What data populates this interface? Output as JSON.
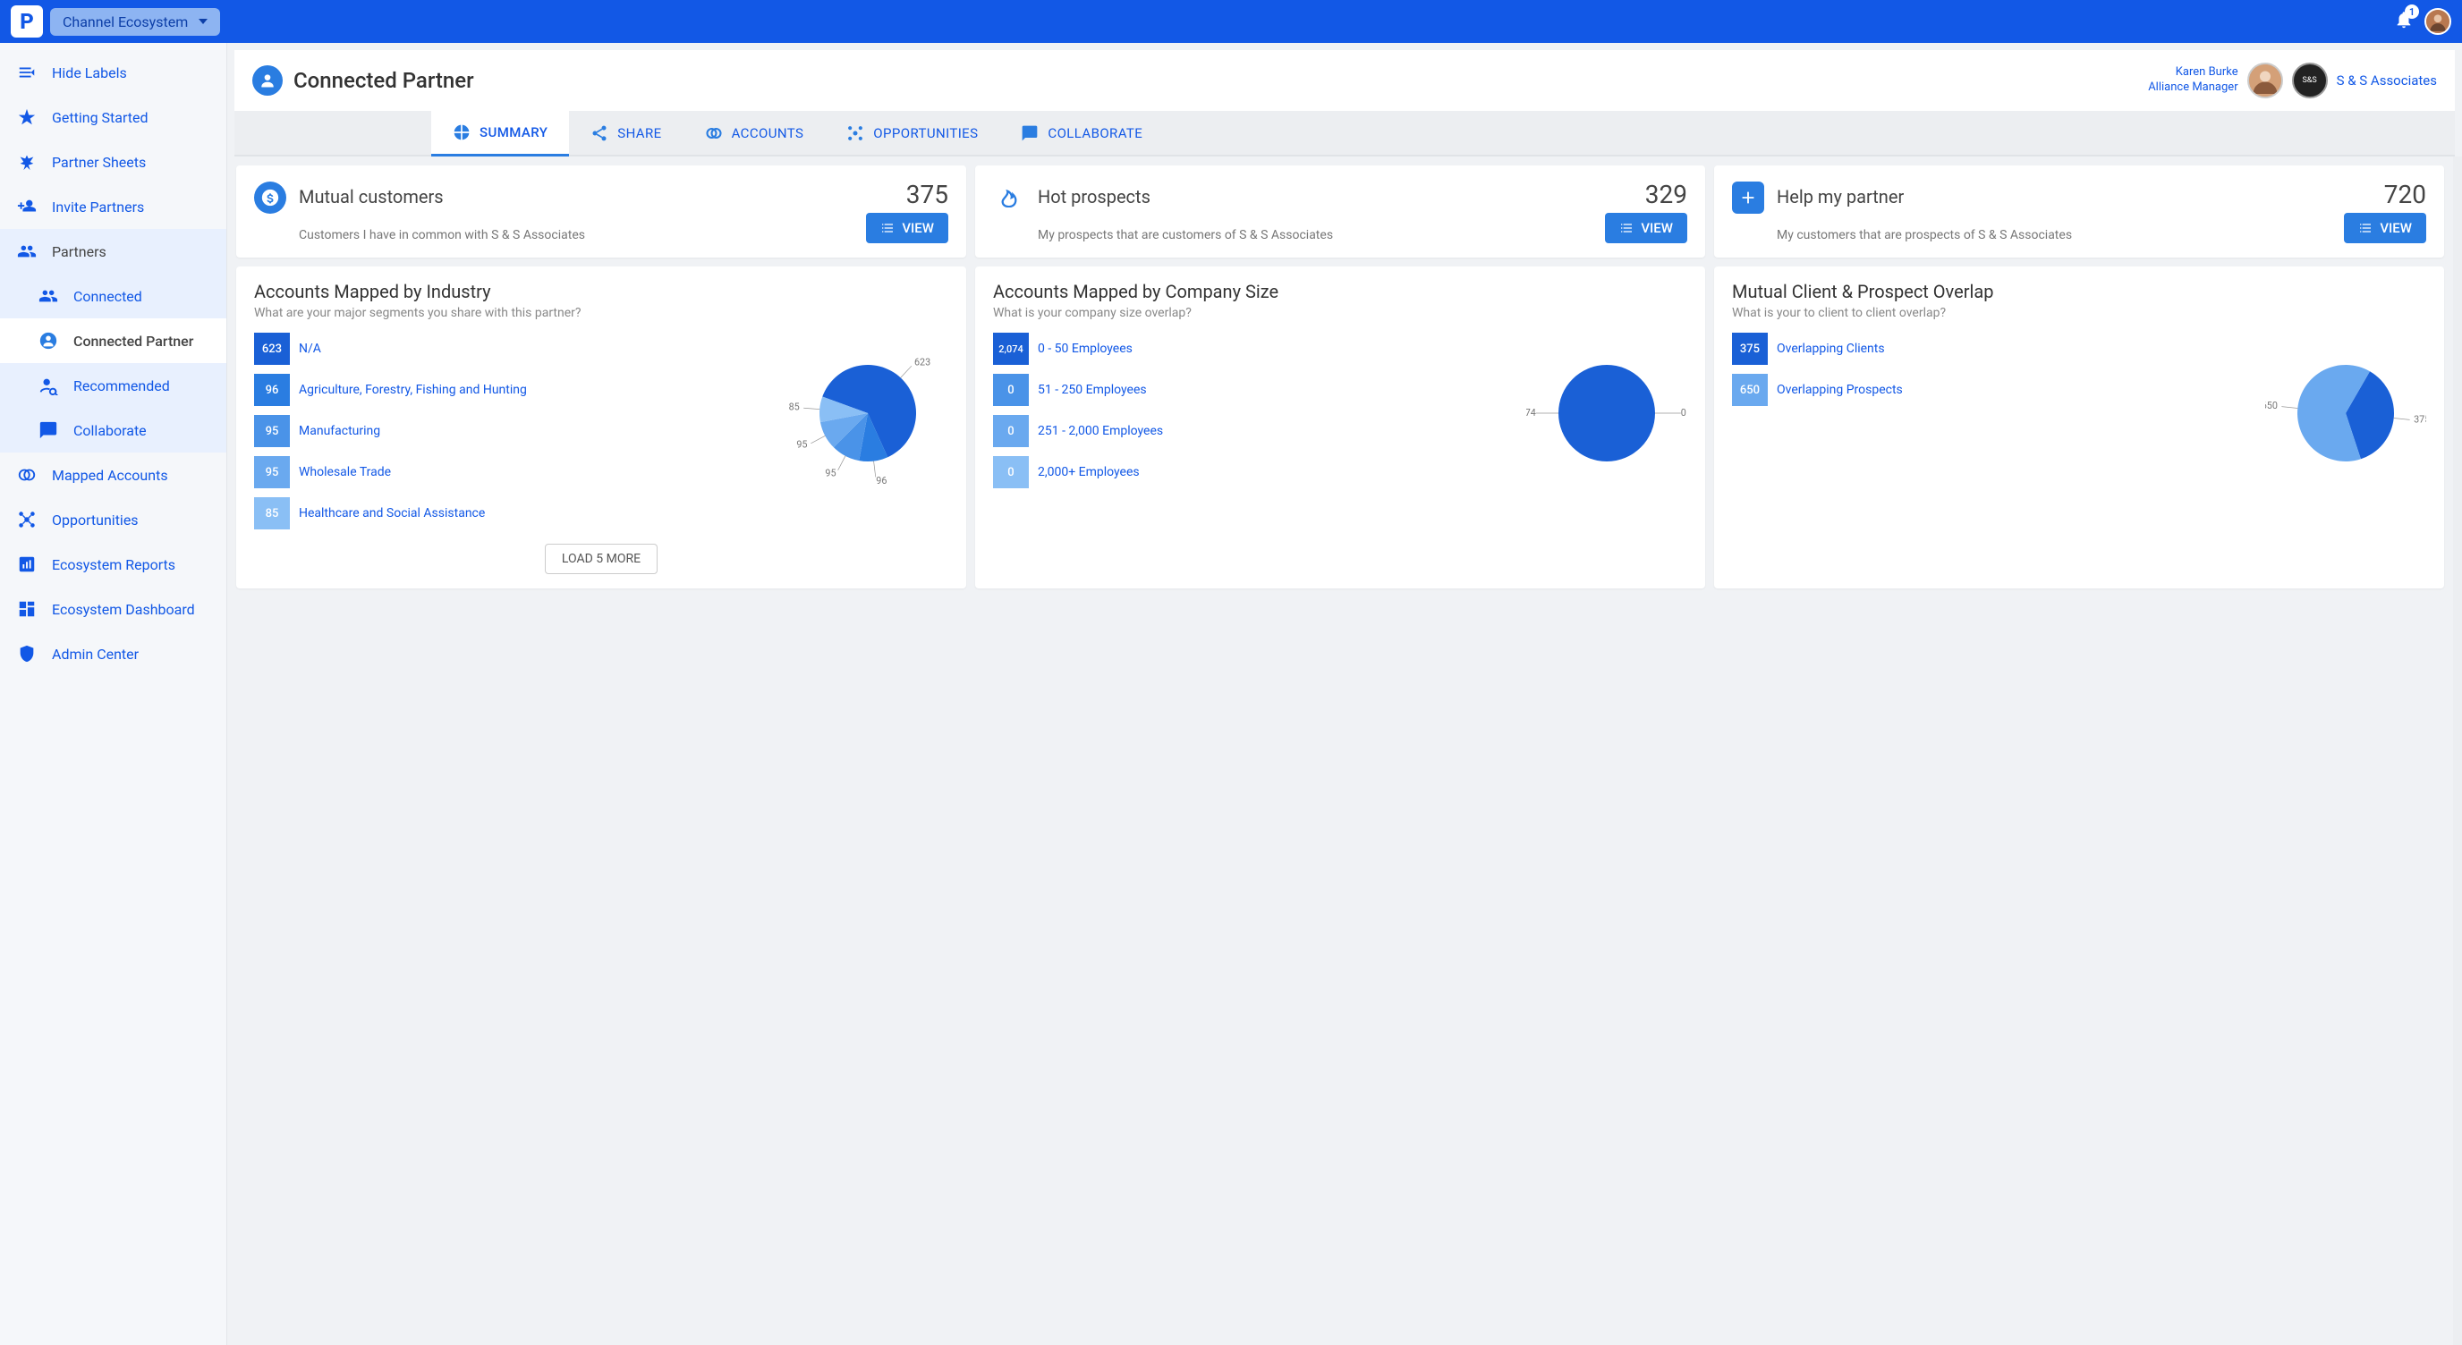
{
  "top": {
    "workspace": "Channel Ecosystem",
    "notif_count": "1"
  },
  "sidebar": {
    "hide_labels": "Hide Labels",
    "items": [
      {
        "label": "Getting Started",
        "icon": "star"
      },
      {
        "label": "Partner Sheets",
        "icon": "wings"
      },
      {
        "label": "Invite Partners",
        "icon": "invite"
      },
      {
        "label": "Partners",
        "icon": "people"
      },
      {
        "label": "Mapped Accounts",
        "icon": "overlap"
      },
      {
        "label": "Opportunities",
        "icon": "network"
      },
      {
        "label": "Ecosystem Reports",
        "icon": "report"
      },
      {
        "label": "Ecosystem Dashboard",
        "icon": "dashboard"
      },
      {
        "label": "Admin Center",
        "icon": "shield"
      }
    ],
    "sub": [
      {
        "label": "Connected",
        "icon": "people"
      },
      {
        "label": "Connected Partner",
        "icon": "person"
      },
      {
        "label": "Recommended",
        "icon": "recommend"
      },
      {
        "label": "Collaborate",
        "icon": "chat"
      }
    ]
  },
  "header": {
    "title": "Connected Partner",
    "user_name": "Karen Burke",
    "user_role": "Alliance Manager",
    "company": "S & S Associates",
    "company_short": "S&S"
  },
  "tabs": [
    {
      "label": "SUMMARY",
      "icon": "pie"
    },
    {
      "label": "SHARE",
      "icon": "share"
    },
    {
      "label": "ACCOUNTS",
      "icon": "overlap"
    },
    {
      "label": "OPPORTUNITIES",
      "icon": "network"
    },
    {
      "label": "COLLABORATE",
      "icon": "chat"
    }
  ],
  "kpis": [
    {
      "title": "Mutual customers",
      "value": "375",
      "sub": "Customers I have in common with S & S Associates",
      "icon": "dollar",
      "color": "#2a7de1"
    },
    {
      "title": "Hot prospects",
      "value": "329",
      "sub": "My prospects that are customers of S & S Associates",
      "icon": "fire",
      "color": "#2a7de1"
    },
    {
      "title": "Help my partner",
      "value": "720",
      "sub": "My customers that are prospects of S & S Associates",
      "icon": "plus",
      "color": "#2a7de1"
    }
  ],
  "view_label": "VIEW",
  "load_more": "LOAD 5 MORE",
  "chart_data": [
    {
      "type": "pie",
      "title": "Accounts Mapped by Industry",
      "subtitle": "What are your major segments you share with this partner?",
      "categories": [
        "N/A",
        "Agriculture, Forestry, Fishing and Hunting",
        "Manufacturing",
        "Wholesale Trade",
        "Healthcare and Social Assistance"
      ],
      "values": [
        623,
        96,
        95,
        95,
        85
      ],
      "colors": [
        "#1a60d6",
        "#2a7de1",
        "#4a93e8",
        "#6aa9ef",
        "#8abff5"
      ]
    },
    {
      "type": "pie",
      "title": "Accounts Mapped by Company Size",
      "subtitle": "What is your company size overlap?",
      "categories": [
        "0 - 50 Employees",
        "51 - 250 Employees",
        "251 - 2,000 Employees",
        "2,000+ Employees"
      ],
      "values": [
        2074,
        0,
        0,
        0
      ],
      "display_values": [
        "2,074",
        "0",
        "0",
        "0"
      ],
      "colors": [
        "#1a60d6",
        "#4a93e8",
        "#6aa9ef",
        "#8abff5"
      ]
    },
    {
      "type": "pie",
      "title": "Mutual Client & Prospect Overlap",
      "subtitle": "What is your to client to client overlap?",
      "categories": [
        "Overlapping Clients",
        "Overlapping Prospects"
      ],
      "values": [
        375,
        650
      ],
      "colors": [
        "#1a60d6",
        "#6aa9ef"
      ]
    }
  ]
}
